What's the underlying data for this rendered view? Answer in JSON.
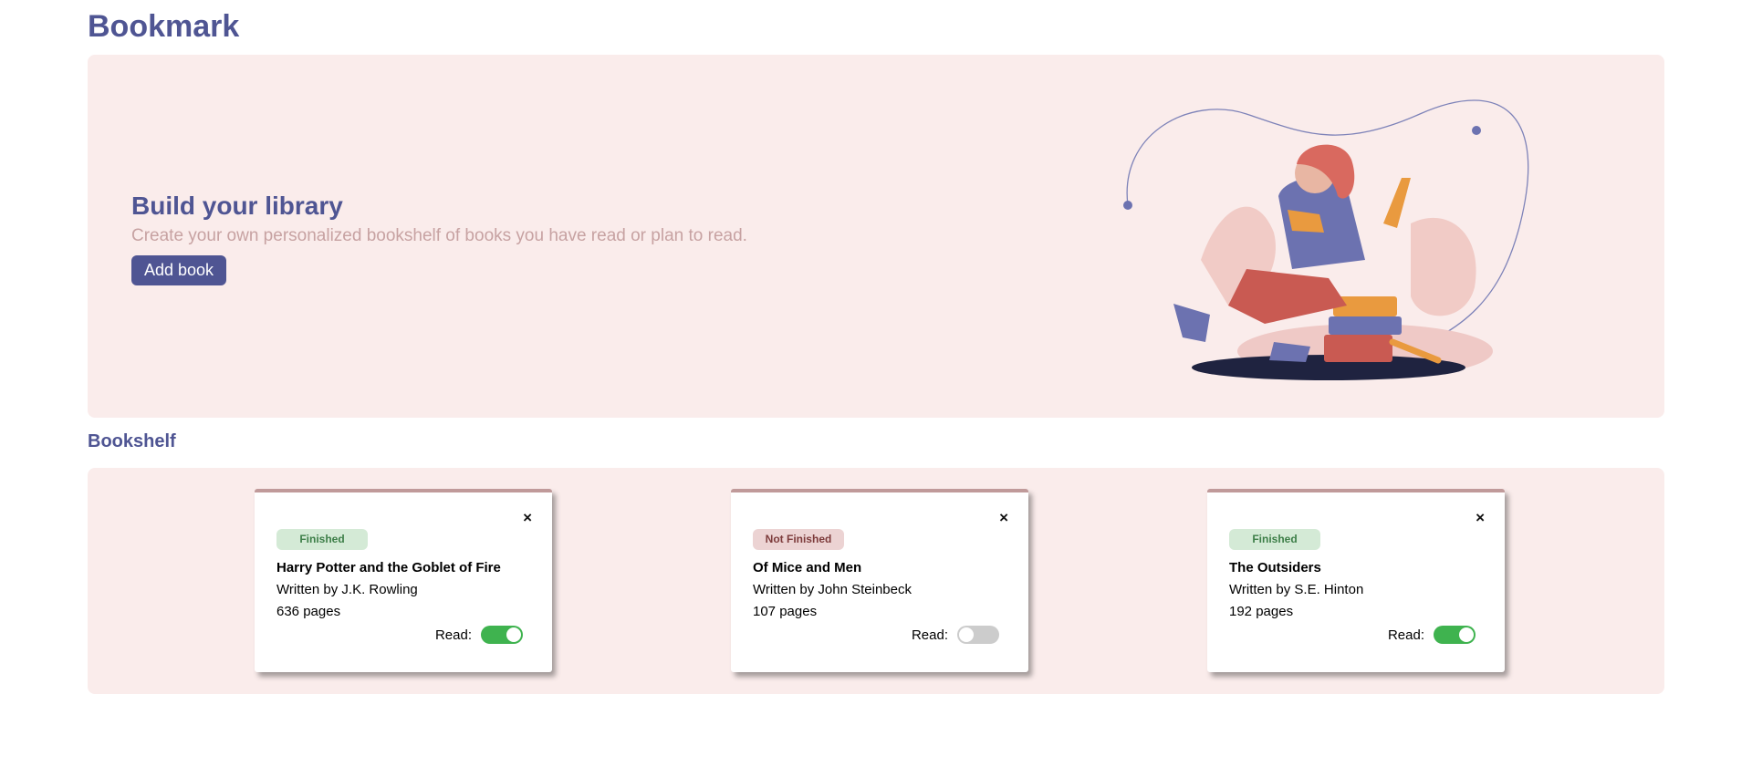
{
  "app": {
    "title": "Bookmark"
  },
  "hero": {
    "title": "Build your library",
    "subtitle": "Create your own personalized bookshelf of books you have read or plan to read.",
    "add_button": "Add book",
    "illustration": "woman-reading-on-books-illustration"
  },
  "bookshelf": {
    "title": "Bookshelf",
    "read_label": "Read:",
    "close_icon": "×",
    "books": [
      {
        "status": "Finished",
        "title": "Harry Potter and the Goblet of Fire",
        "author": "Written by J.K. Rowling",
        "pages": "636 pages",
        "read": true
      },
      {
        "status": "Not Finished",
        "title": "Of Mice and Men",
        "author": "Written by John Steinbeck",
        "pages": "107 pages",
        "read": false
      },
      {
        "status": "Finished",
        "title": "The Outsiders",
        "author": "Written by S.E. Hinton",
        "pages": "192 pages",
        "read": true
      }
    ]
  },
  "colors": {
    "accent": "#4f5593",
    "panel": "#faeceb",
    "toggle_on": "#3fb34f",
    "toggle_off": "#cccccc"
  }
}
